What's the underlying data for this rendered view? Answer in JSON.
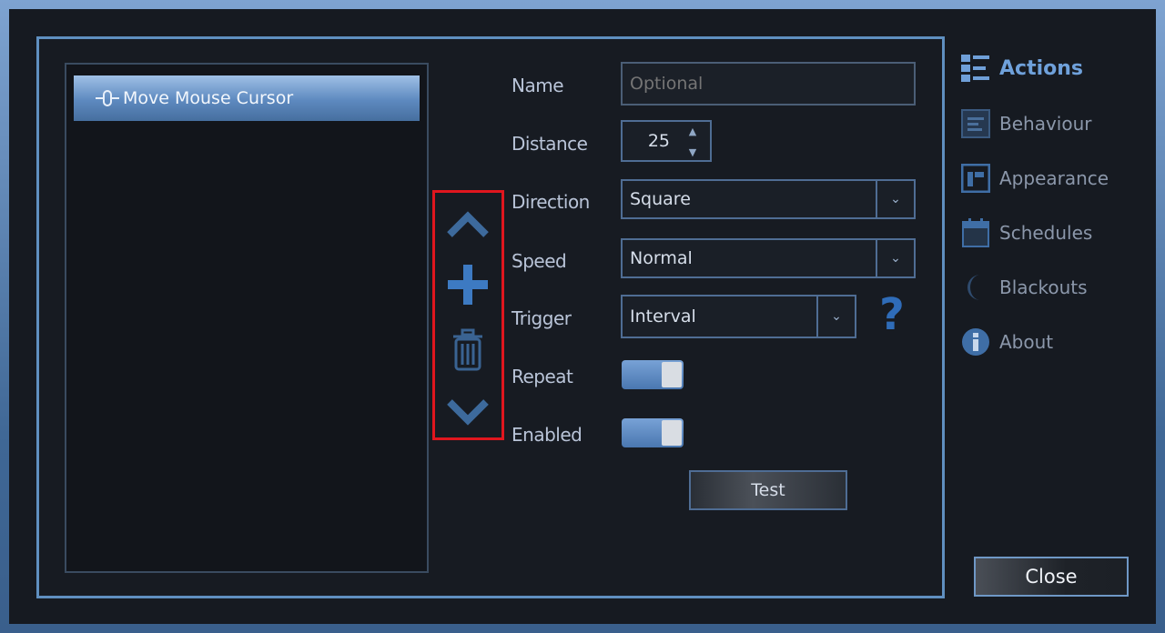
{
  "list": {
    "items": [
      {
        "label": "Move Mouse Cursor",
        "icon": "mouse-move-icon"
      }
    ]
  },
  "controls": {
    "move_up_icon": "chevron-up-icon",
    "add_icon": "plus-icon",
    "delete_icon": "trash-icon",
    "move_down_icon": "chevron-down-icon"
  },
  "form": {
    "name": {
      "label": "Name",
      "placeholder": "Optional",
      "value": ""
    },
    "distance": {
      "label": "Distance",
      "value": "25"
    },
    "direction": {
      "label": "Direction",
      "value": "Square"
    },
    "speed": {
      "label": "Speed",
      "value": "Normal"
    },
    "trigger": {
      "label": "Trigger",
      "value": "Interval",
      "help": "?"
    },
    "repeat": {
      "label": "Repeat",
      "on": true
    },
    "enabled": {
      "label": "Enabled",
      "on": true
    },
    "test_label": "Test"
  },
  "nav": {
    "items": [
      {
        "label": "Actions",
        "icon": "actions-list-icon",
        "active": true
      },
      {
        "label": "Behaviour",
        "icon": "behaviour-icon",
        "active": false
      },
      {
        "label": "Appearance",
        "icon": "appearance-icon",
        "active": false
      },
      {
        "label": "Schedules",
        "icon": "calendar-icon",
        "active": false
      },
      {
        "label": "Blackouts",
        "icon": "moon-icon",
        "active": false
      },
      {
        "label": "About",
        "icon": "info-icon",
        "active": false
      }
    ]
  },
  "close_label": "Close",
  "colors": {
    "accent": "#5f8fc0",
    "highlight_box": "#e0161e",
    "toggle_on": "#5f8fc8"
  }
}
